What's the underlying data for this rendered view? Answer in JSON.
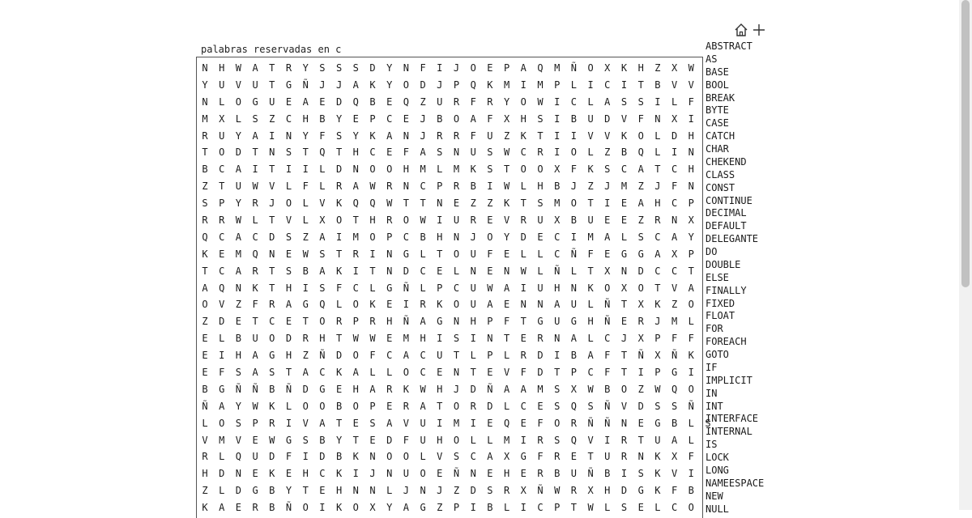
{
  "title": "palabras reservadas en c",
  "toolbar": {
    "home_icon": "home-icon",
    "add_icon": "plus-icon"
  },
  "grid_rows": [
    "NHWATRYSSSDYNFIJOEPAQMÑOXKHZXW",
    "YUVUTGÑJJAKYODJPQKMIMPLICITBVV",
    "NLOGUEAEDQBEQZURFRYOWICLASSILF",
    "MXLSZCHBYEPCEJBOAFXHSIBUDVFNXI",
    "RUYAINYFSYKANJRRFUZKTIIVVKOLDH",
    "TODTNSTQTHCEFASNUSWCRIOLZBQLIN",
    "BCAITIILDNOOHMLMKSTOOXFKSCATCH",
    "ZTUWVLFLRAWRNCPRBIWLHBJZJMZJFN",
    "SPYRJOLVKQQWTTNEZZKTSMOTIEAHCP",
    "RRWLTVLXOTHROWIUREVRUXBUEEZRNX",
    "QCACDSZAIMOPCBHNJOYDECIMALSCAY",
    "KEMQNEWSTRINGLTOUFELLCÑFEGGAXP",
    "TCARTSBAKITNDCELNENWLÑLTXNDCCT",
    "AQNKTHISFCLGÑLPCUWAIUHNKOXOTVA",
    "OVZFRAGQLOKEIRKOUAENNAULÑTXKZO",
    "ZDETCETORPRHÑAGNHPFTGUGHÑERJML",
    "ELBUODRHTWWEMHISINTERNALCJXPFF",
    "EIHAGHZÑDOFCACUTLPLRDIBAFTÑXÑK",
    "EFSASTACKALLOCENTEVFDTPCFTIPGI",
    "BGÑÑBÑDGEHARKWHJDÑAAMSXWBOZWQO",
    "ÑAYWKLOOBOPERATORDLCESQSÑVDSSÑ",
    "LOSPRIVATESAVUIMIEQEFORÑÑNEGBLS",
    "VMVEWGSBYTEDFUHOLLMIRSQVIRTUAL",
    "RLQUDFIDBKNOOLVSCAXGFRETURNKXF",
    "HDNEKEHCKIJNUOEÑNEHERBUÑBISKVI",
    "ZLDGBYTEHNNLJNJZDSRXÑWRXHDGKFB",
    "KAERBÑOIKOXYAGZPIBLICPTWLSELCO"
  ],
  "words": [
    "ABSTRACT",
    "AS",
    "BASE",
    "BOOL",
    "BREAK",
    "BYTE",
    "CASE",
    "CATCH",
    "CHAR",
    "CHEKEND",
    "CLASS",
    "CONST",
    "CONTINUE",
    "DECIMAL",
    "DEFAULT",
    "DELEGANTE",
    "DO",
    "DOUBLE",
    "ELSE",
    "FINALLY",
    "FIXED",
    "FLOAT",
    "FOR",
    "FOREACH",
    "GOTO",
    "IF",
    "IMPLICIT",
    "IN",
    "INT",
    "INTERFACE",
    "INTERNAL",
    "IS",
    "LOCK",
    "LONG",
    "NAMEESPACE",
    "NEW",
    "NULL"
  ],
  "colors": {
    "text": "#1a1a1a",
    "border": "#555555",
    "scrollbar_thumb": "#c1c1c1"
  }
}
